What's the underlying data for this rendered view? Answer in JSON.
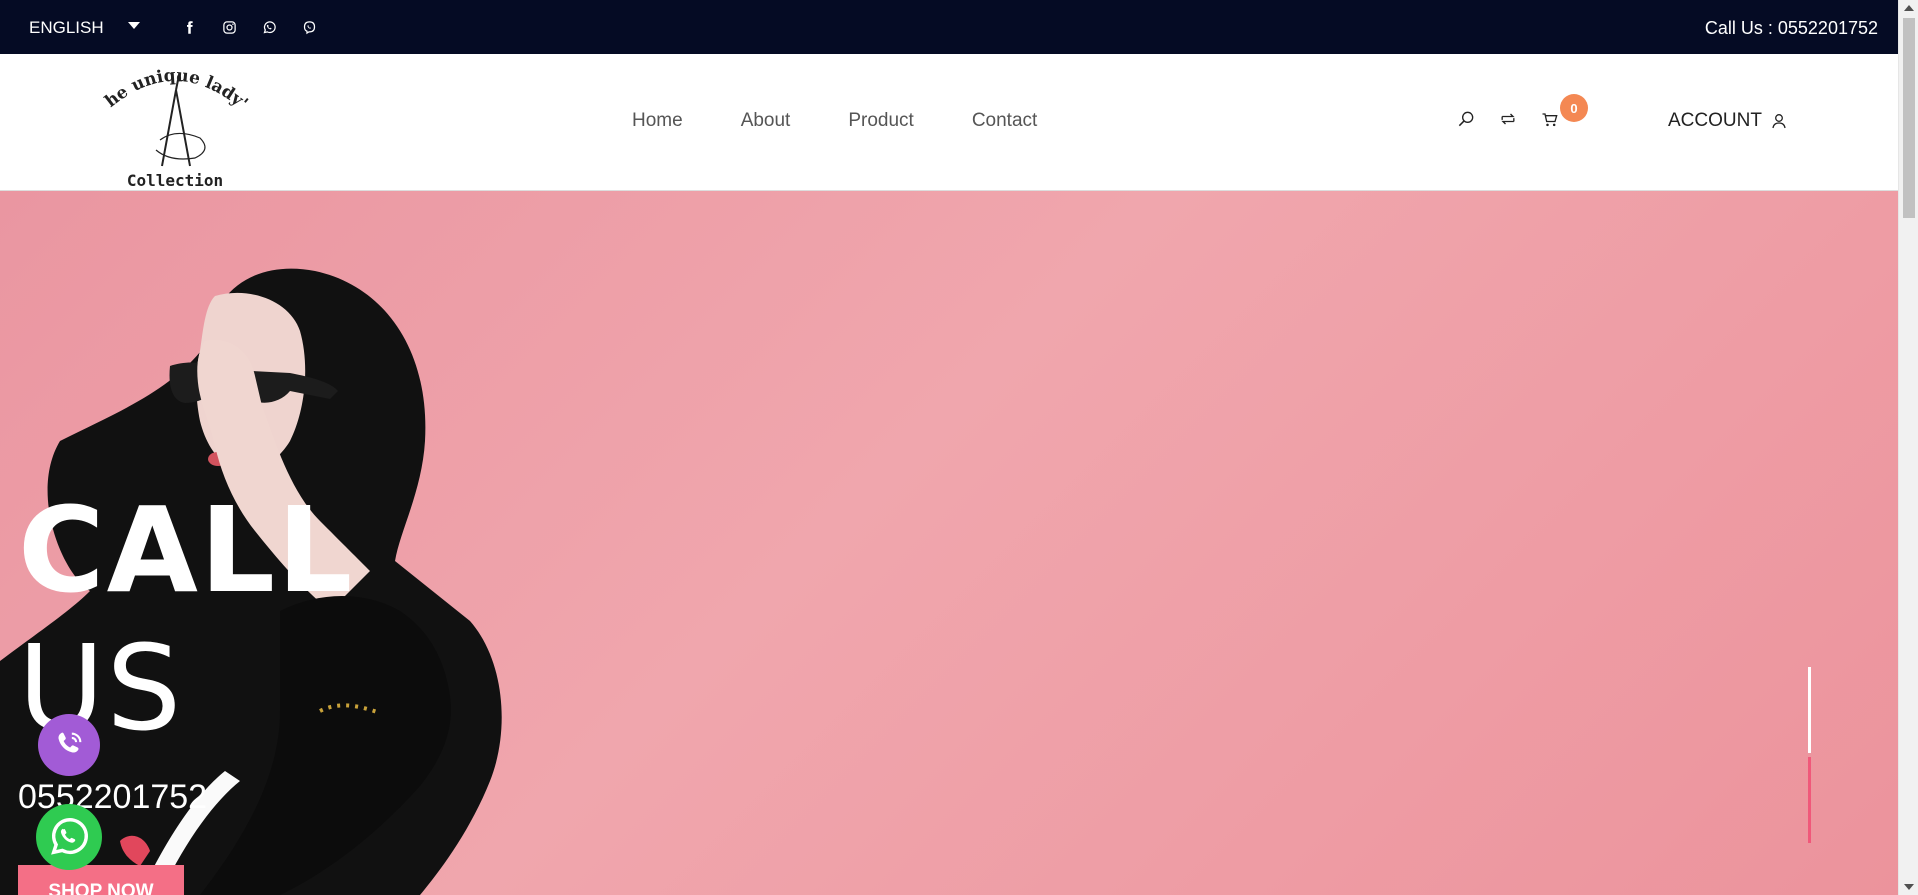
{
  "topbar": {
    "language": "ENGLISH",
    "socials": [
      "facebook-icon",
      "instagram-icon",
      "whatsapp-icon",
      "viber-icon"
    ],
    "call_text": "Call Us : 0552201752"
  },
  "header": {
    "logo_text_top": "The unique lady's",
    "logo_text_bottom": "Collection",
    "nav": [
      {
        "label": "Home"
      },
      {
        "label": "About"
      },
      {
        "label": "Product"
      },
      {
        "label": "Contact"
      }
    ],
    "cart_count": "0",
    "account_label": "ACCOUNT"
  },
  "hero": {
    "title_line1": "CALL",
    "title_line2": "US",
    "phone": "0552201752",
    "cta": "SHOP NOW",
    "background_color": "#ee9ea7",
    "accent_color": "#f46f86"
  },
  "colors": {
    "topbar": "#050b24",
    "badge": "#f48853",
    "viber": "#a25bd6",
    "whatsapp": "#2fcb51"
  }
}
